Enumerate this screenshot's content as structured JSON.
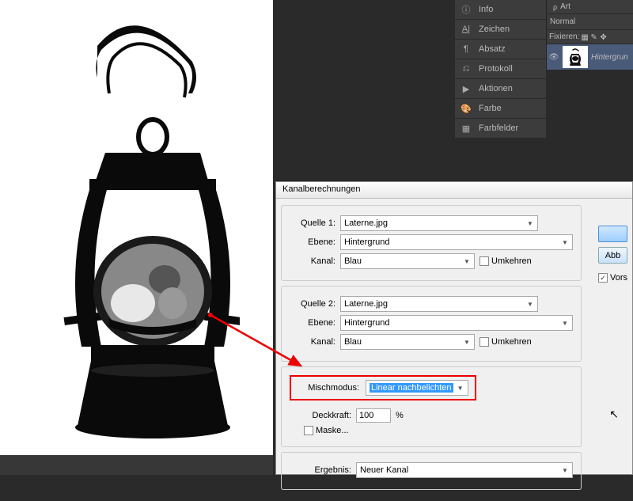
{
  "panels": {
    "info": "Info",
    "zeichen": "Zeichen",
    "absatz": "Absatz",
    "protokoll": "Protokoll",
    "aktionen": "Aktionen",
    "farbe": "Farbe",
    "farbfelder": "Farbfelder"
  },
  "layers": {
    "sort_label": "Art",
    "blend": "Normal",
    "lock_label": "Fixieren:",
    "layer_name": "Hintergrun"
  },
  "dialog": {
    "title": "Kanalberechnungen",
    "source1_label": "Quelle 1:",
    "source2_label": "Quelle 2:",
    "layer_label": "Ebene:",
    "channel_label": "Kanal:",
    "invert_label": "Umkehren",
    "blend_label": "Mischmodus:",
    "opacity_label": "Deckkraft:",
    "opacity_value": "100",
    "opacity_unit": "%",
    "mask_label": "Maske...",
    "result_label": "Ergebnis:",
    "file": "Laterne.jpg",
    "bg": "Hintergrund",
    "channel": "Blau",
    "blend_value": "Linear nachbelichten",
    "result_value": "Neuer Kanal",
    "btn_cancel": "Abb",
    "preview_label": "Vors"
  }
}
